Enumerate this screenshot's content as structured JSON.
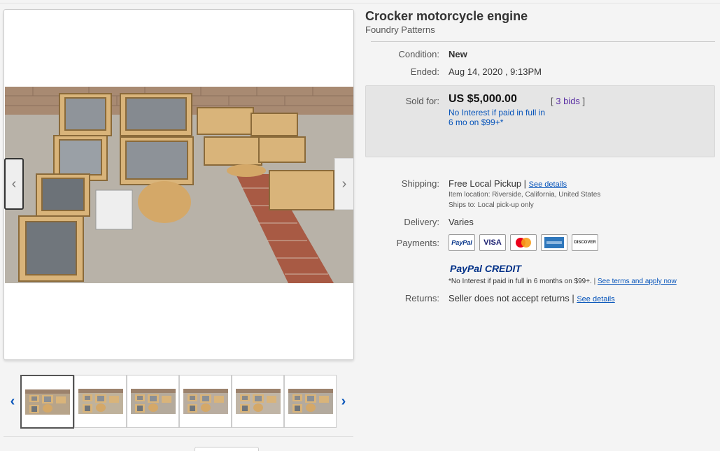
{
  "listing": {
    "title": "Crocker motorcycle engine",
    "subtitle": "Foundry Patterns"
  },
  "details": {
    "condition_label": "Condition:",
    "condition_value": "New",
    "ended_label": "Ended:",
    "ended_value": "Aug 14, 2020 , 9:13PM",
    "sold_label": "Sold for:",
    "sold_price": "US $5,000.00",
    "bids_open": "[ ",
    "bids_link": "3 bids",
    "bids_close": " ]",
    "no_interest": "No Interest if paid in full in 6 mo on $99+*",
    "shipping_label": "Shipping:",
    "shipping_value": "Free Local Pickup",
    "shipping_sep": " | ",
    "shipping_link": "See details",
    "item_location": "Item location:  Riverside, California, United States",
    "ships_to": "Ships to:  Local pick-up only",
    "delivery_label": "Delivery:",
    "delivery_value": "Varies",
    "payments_label": "Payments:",
    "paypal_credit_pp": "PayPal",
    "paypal_credit_cr": " CREDIT",
    "credit_note": "*No Interest if paid in full in 6 months on $99+.",
    "credit_sep": "  |  ",
    "credit_link": "See terms and apply now",
    "returns_label": "Returns:",
    "returns_value": "Seller does not accept returns",
    "returns_sep": " | ",
    "returns_link": "See details"
  },
  "payments": [
    {
      "name": "PayPal",
      "color": "#003087"
    },
    {
      "name": "VISA",
      "color": "#1a1f71"
    },
    {
      "name": "",
      "color": "#eb001b"
    },
    {
      "name": "",
      "color": "#2e77bc"
    },
    {
      "name": "DISCOVER",
      "color": "#f58220"
    }
  ],
  "icons": {
    "prev_photo": "‹",
    "next_photo": "›",
    "prev_thumbs": "‹",
    "next_thumbs": "›"
  },
  "thumbnail_count": 6,
  "colors": {
    "link": "#0654ba",
    "sold_box": "#e5e5e5",
    "bids_link": "#5a2fa3"
  }
}
